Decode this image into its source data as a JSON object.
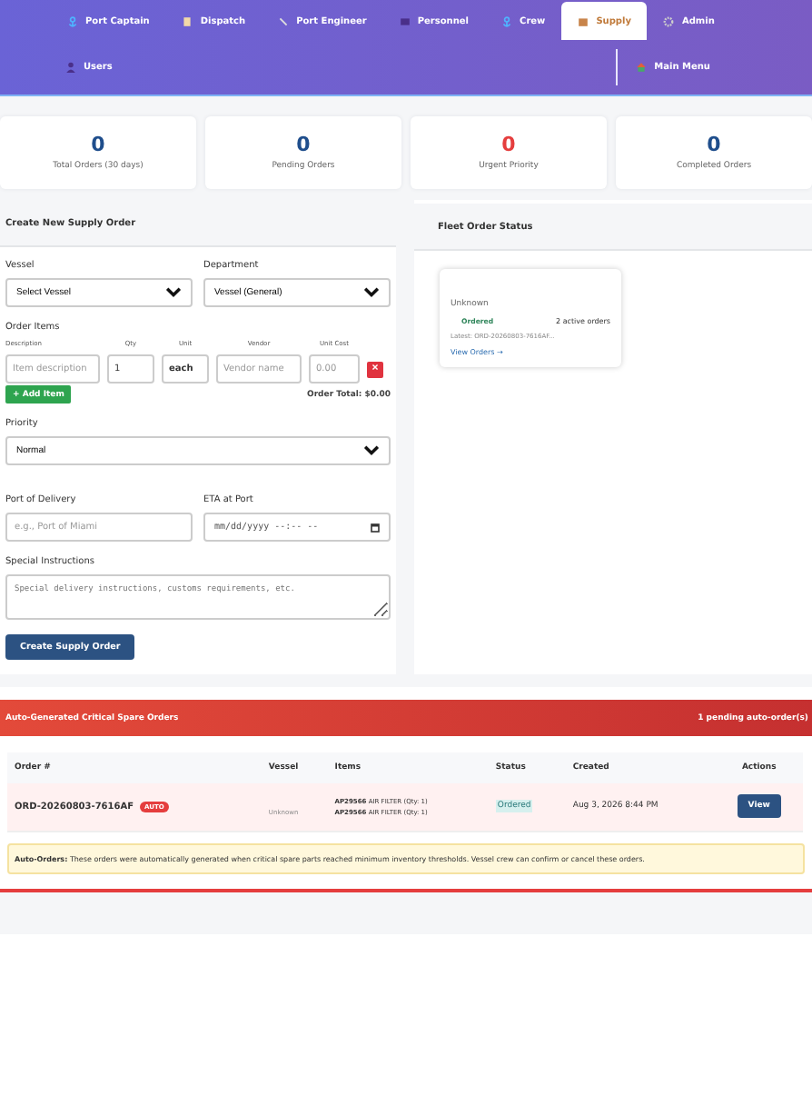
{
  "nav": {
    "tabs": [
      {
        "label": "Port Captain",
        "selected": false
      },
      {
        "label": "Dispatch",
        "selected": false
      },
      {
        "label": "Port Engineer",
        "selected": false
      },
      {
        "label": "Personnel",
        "selected": false
      },
      {
        "label": "Crew",
        "selected": false
      },
      {
        "label": "Supply",
        "selected": true
      },
      {
        "label": "Admin",
        "selected": false
      }
    ],
    "users": "Users",
    "main_menu": "Main Menu"
  },
  "stats": [
    {
      "value": "0",
      "label": "Total Orders (30 days)",
      "color": "#1f4e8c"
    },
    {
      "value": "0",
      "label": "Pending Orders",
      "color": "#1f4e8c"
    },
    {
      "value": "0",
      "label": "Urgent Priority",
      "color": "#e53e3e"
    },
    {
      "value": "0",
      "label": "Completed Orders",
      "color": "#1f4e8c"
    }
  ],
  "order_form": {
    "title": "Create New Supply Order",
    "vessel": {
      "label": "Vessel",
      "value": "Select Vessel"
    },
    "department": {
      "label": "Department",
      "value": "Vessel (General)"
    },
    "items_label": "Order Items",
    "item_columns": [
      "Description",
      "Qty",
      "Unit",
      "Vendor",
      "Unit Cost"
    ],
    "item": {
      "description": {
        "placeholder": "Item description"
      },
      "qty": "1",
      "unit": "each",
      "vendor": {
        "placeholder": "Vendor name"
      },
      "unit_cost": {
        "placeholder": "0.00"
      },
      "remove": "×"
    },
    "add_item": "+ Add Item",
    "order_total": "Order Total: $0.00",
    "priority": {
      "label": "Priority",
      "value": "Normal"
    },
    "port": {
      "label": "Port of Delivery",
      "placeholder": "e.g., Port of Miami"
    },
    "eta": {
      "label": "ETA at Port",
      "placeholder": "mm/dd/yyyy --:-- --"
    },
    "instructions": {
      "label": "Special Instructions",
      "placeholder": "Special delivery instructions, customs requirements, etc."
    },
    "submit": "Create Supply Order"
  },
  "fleet": {
    "title": "Fleet Order Status",
    "cards": [
      {
        "subtitle": "Unknown",
        "status": "Ordered",
        "count": "2 active orders",
        "latest": "Latest: ORD-20260803-7616AF...",
        "link": "View Orders →"
      }
    ]
  },
  "auto_orders": {
    "title": "Auto-Generated Critical Spare Orders",
    "badge": "1 pending auto-order(s)",
    "columns": [
      "Order #",
      "Vessel",
      "Items",
      "Status",
      "Created",
      "Actions"
    ],
    "rows": [
      {
        "order": "ORD-20260803-7616AF",
        "tag": "AUTO",
        "vessel_sub": "Unknown",
        "items": [
          {
            "code": "AP29566",
            "text": "AIR FILTER (Qty: 1)"
          },
          {
            "code": "AP29566",
            "text": "AIR FILTER (Qty: 1)"
          }
        ],
        "status": "Ordered",
        "created": "Aug 3, 2026 8:44 PM",
        "action": "View"
      }
    ],
    "note": "**Auto-Orders:** These orders were automatically generated when critical spare parts reached minimum inventory thresholds. Vessel crew can confirm or cancel these orders."
  }
}
